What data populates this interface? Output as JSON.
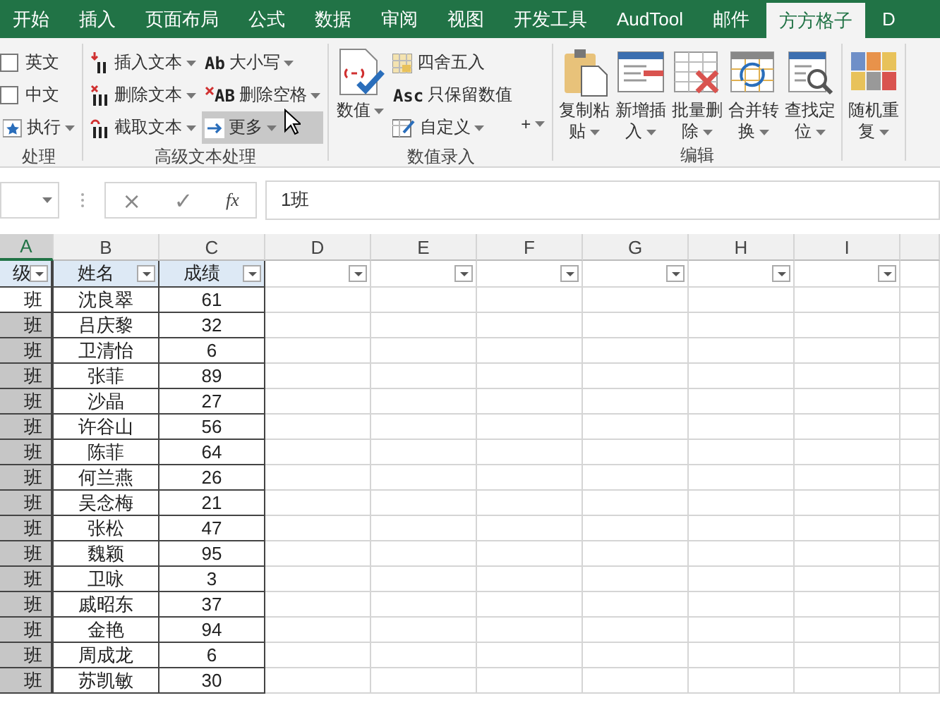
{
  "tabs": [
    {
      "label": "开始",
      "selected": false
    },
    {
      "label": "插入",
      "selected": false
    },
    {
      "label": "页面布局",
      "selected": false
    },
    {
      "label": "公式",
      "selected": false
    },
    {
      "label": "数据",
      "selected": false
    },
    {
      "label": "审阅",
      "selected": false
    },
    {
      "label": "视图",
      "selected": false
    },
    {
      "label": "开发工具",
      "selected": false
    },
    {
      "label": "AudTool",
      "selected": false
    },
    {
      "label": "邮件",
      "selected": false
    },
    {
      "label": "方方格子",
      "selected": true
    },
    {
      "label": "D",
      "selected": false
    }
  ],
  "ribbon": {
    "groups": [
      {
        "label": "处理",
        "columns": [
          {
            "kind": "stack",
            "items": [
              {
                "kind": "check",
                "label": "英文",
                "checked": false
              },
              {
                "kind": "check",
                "label": "中文",
                "checked": false
              },
              {
                "kind": "command",
                "label": "执行",
                "dropdown": true,
                "hovered": false
              }
            ]
          }
        ]
      },
      {
        "label": "高级文本处理",
        "columns": [
          {
            "kind": "stack",
            "items": [
              {
                "kind": "command",
                "label": "插入文本",
                "dropdown": true,
                "hovered": false
              },
              {
                "kind": "command",
                "label": "删除文本",
                "dropdown": true,
                "hovered": false
              },
              {
                "kind": "command",
                "label": "截取文本",
                "dropdown": true,
                "hovered": false
              }
            ]
          },
          {
            "kind": "stack",
            "items": [
              {
                "kind": "command",
                "icon_text": "Ab",
                "label": "大小写",
                "dropdown": true,
                "hovered": false
              },
              {
                "kind": "command",
                "icon_text": "AB",
                "label": "删除空格",
                "dropdown": true,
                "hovered": false
              },
              {
                "kind": "command",
                "label": "更多",
                "dropdown": true,
                "hovered": true
              }
            ]
          }
        ]
      },
      {
        "label": "数值录入",
        "columns": [
          {
            "kind": "large",
            "label": "数值",
            "dropdown": true,
            "hovered": false
          },
          {
            "kind": "stack",
            "items": [
              {
                "kind": "command",
                "label": "四舍五入",
                "dropdown": false,
                "hovered": false
              },
              {
                "kind": "command",
                "icon_text": "Asc",
                "label": "只保留数值",
                "dropdown": false,
                "hovered": false
              },
              {
                "kind": "command",
                "label": "自定义",
                "dropdown": true,
                "hovered": false
              }
            ]
          },
          {
            "kind": "stack",
            "items": [
              {
                "kind": "command",
                "label": "+",
                "dropdown": true,
                "hovered": false
              }
            ]
          }
        ]
      },
      {
        "label": "编辑",
        "columns": [
          {
            "kind": "large",
            "label": "复制粘贴",
            "dropdown": true,
            "hovered": false
          },
          {
            "kind": "large",
            "label": "新增插入",
            "dropdown": true,
            "hovered": false
          },
          {
            "kind": "large",
            "label": "批量删除",
            "dropdown": true,
            "hovered": false
          },
          {
            "kind": "large",
            "label": "合并转换",
            "dropdown": true,
            "hovered": false
          },
          {
            "kind": "large",
            "label": "查找定位",
            "dropdown": true,
            "hovered": false
          }
        ]
      },
      {
        "columns": [
          {
            "kind": "large",
            "label": "随机重复",
            "dropdown": true,
            "hovered": false
          }
        ]
      }
    ]
  },
  "formula_bar": {
    "cancel": "×",
    "enter": "✓",
    "function_label": "fx",
    "value": "1班"
  },
  "sheet": {
    "columns": [
      {
        "letter": "A",
        "selected": true,
        "header": "级"
      },
      {
        "letter": "B",
        "selected": false,
        "header": "姓名"
      },
      {
        "letter": "C",
        "selected": false,
        "header": "成绩"
      },
      {
        "letter": "D",
        "selected": false
      },
      {
        "letter": "E",
        "selected": false
      },
      {
        "letter": "F",
        "selected": false
      },
      {
        "letter": "G",
        "selected": false
      },
      {
        "letter": "H",
        "selected": false
      },
      {
        "letter": "I",
        "selected": false
      }
    ],
    "rows": [
      {
        "class": "班",
        "name": "沈良翠",
        "score": "61",
        "active": true
      },
      {
        "class": "班",
        "name": "吕庆黎",
        "score": "32",
        "active": false
      },
      {
        "class": "班",
        "name": "卫清怡",
        "score": "6",
        "active": false
      },
      {
        "class": "班",
        "name": "张菲",
        "score": "89",
        "active": false
      },
      {
        "class": "班",
        "name": "沙晶",
        "score": "27",
        "active": false
      },
      {
        "class": "班",
        "name": "许谷山",
        "score": "56",
        "active": false
      },
      {
        "class": "班",
        "name": "陈菲",
        "score": "64",
        "active": false
      },
      {
        "class": "班",
        "name": "何兰燕",
        "score": "26",
        "active": false
      },
      {
        "class": "班",
        "name": "吴念梅",
        "score": "21",
        "active": false
      },
      {
        "class": "班",
        "name": "张松",
        "score": "47",
        "active": false
      },
      {
        "class": "班",
        "name": "魏颖",
        "score": "95",
        "active": false
      },
      {
        "class": "班",
        "name": "卫咏",
        "score": "3",
        "active": false
      },
      {
        "class": "班",
        "name": "戚昭东",
        "score": "37",
        "active": false
      },
      {
        "class": "班",
        "name": "金艳",
        "score": "94",
        "active": false
      },
      {
        "class": "班",
        "name": "周成龙",
        "score": "6",
        "active": false
      },
      {
        "class": "班",
        "name": "苏凯敏",
        "score": "30",
        "active": false
      }
    ]
  }
}
